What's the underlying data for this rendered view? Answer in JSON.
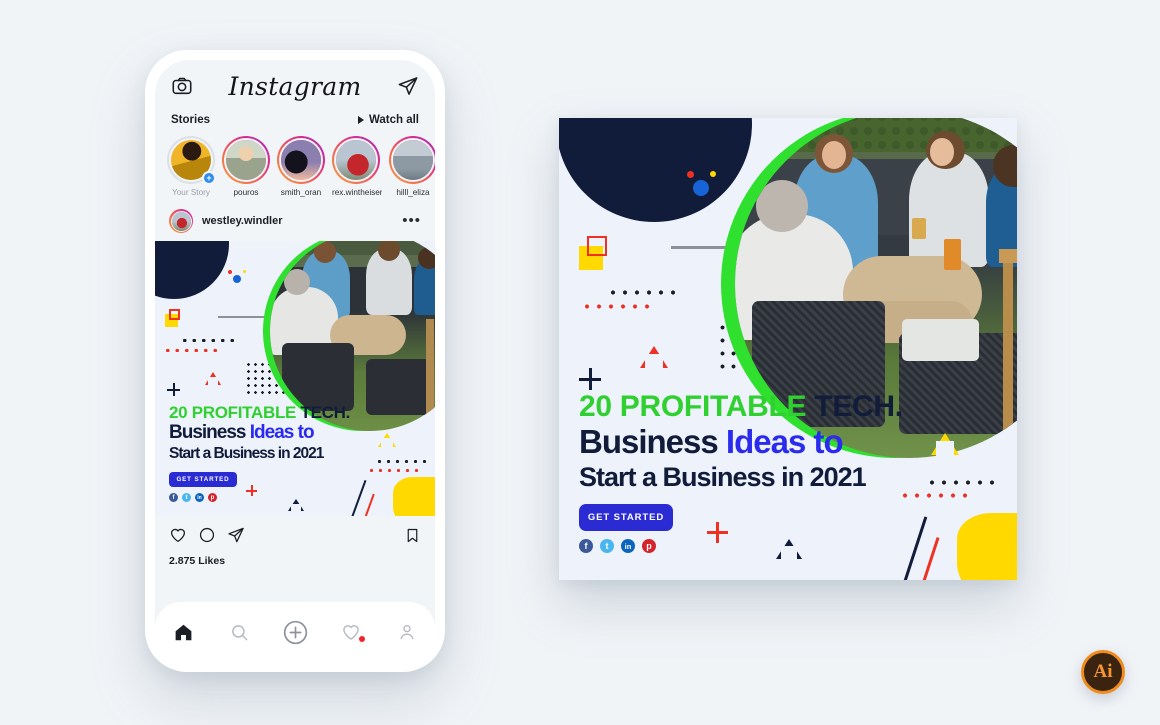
{
  "page": {
    "background": "#f1f4f7"
  },
  "phone": {
    "ig_header": {
      "camera_icon": "camera-icon",
      "logo": "Instagram",
      "send_icon": "paper-plane-icon"
    },
    "stories": {
      "label": "Stories",
      "watch_all": "Watch all",
      "items": [
        {
          "name": "Your Story",
          "has_add": true,
          "muted": true
        },
        {
          "name": "pouros",
          "has_add": false,
          "muted": false
        },
        {
          "name": "smith_oran",
          "has_add": false,
          "muted": false
        },
        {
          "name": "rex.wintheiser",
          "has_add": false,
          "muted": false
        },
        {
          "name": "hilll_eliza",
          "has_add": false,
          "muted": false
        }
      ]
    },
    "post": {
      "username": "westley.windler",
      "more_icon": "more-options-icon",
      "like_icon": "heart-icon",
      "comment_icon": "comment-icon",
      "share_icon": "paper-plane-icon",
      "save_icon": "bookmark-icon",
      "likes": "2.875 Likes"
    },
    "tabbar": {
      "home": "home-icon",
      "search": "search-icon",
      "add": "add-post-icon",
      "activity": "heart-icon",
      "profile": "profile-icon"
    }
  },
  "creative": {
    "headline": {
      "line1_green": "20 PROFITABLE",
      "line1_navy": "TECH.",
      "line2_navy": "Business",
      "line2_blue": "Ideas to",
      "line3": "Start a Business in 2021"
    },
    "cta_label": "GET STARTED",
    "socials": [
      {
        "name": "facebook-icon",
        "glyph": "f",
        "color": "#3b5998"
      },
      {
        "name": "twitter-icon",
        "glyph": "t",
        "color": "#49b6f0"
      },
      {
        "name": "linkedin-icon",
        "glyph": "in",
        "color": "#0c65bd"
      },
      {
        "name": "pinterest-icon",
        "glyph": "p",
        "color": "#d5232b"
      }
    ],
    "colors": {
      "green": "#2fd02f",
      "navy": "#111c3a",
      "blue": "#2b2bef",
      "cta_blue": "#2b2bd4",
      "yellow": "#ffd900",
      "red": "#ef3124",
      "canvas": "#edf2fb"
    },
    "photo_caption": "group of men relaxing on outdoor patio furniture"
  },
  "badge": {
    "label": "Ai"
  }
}
